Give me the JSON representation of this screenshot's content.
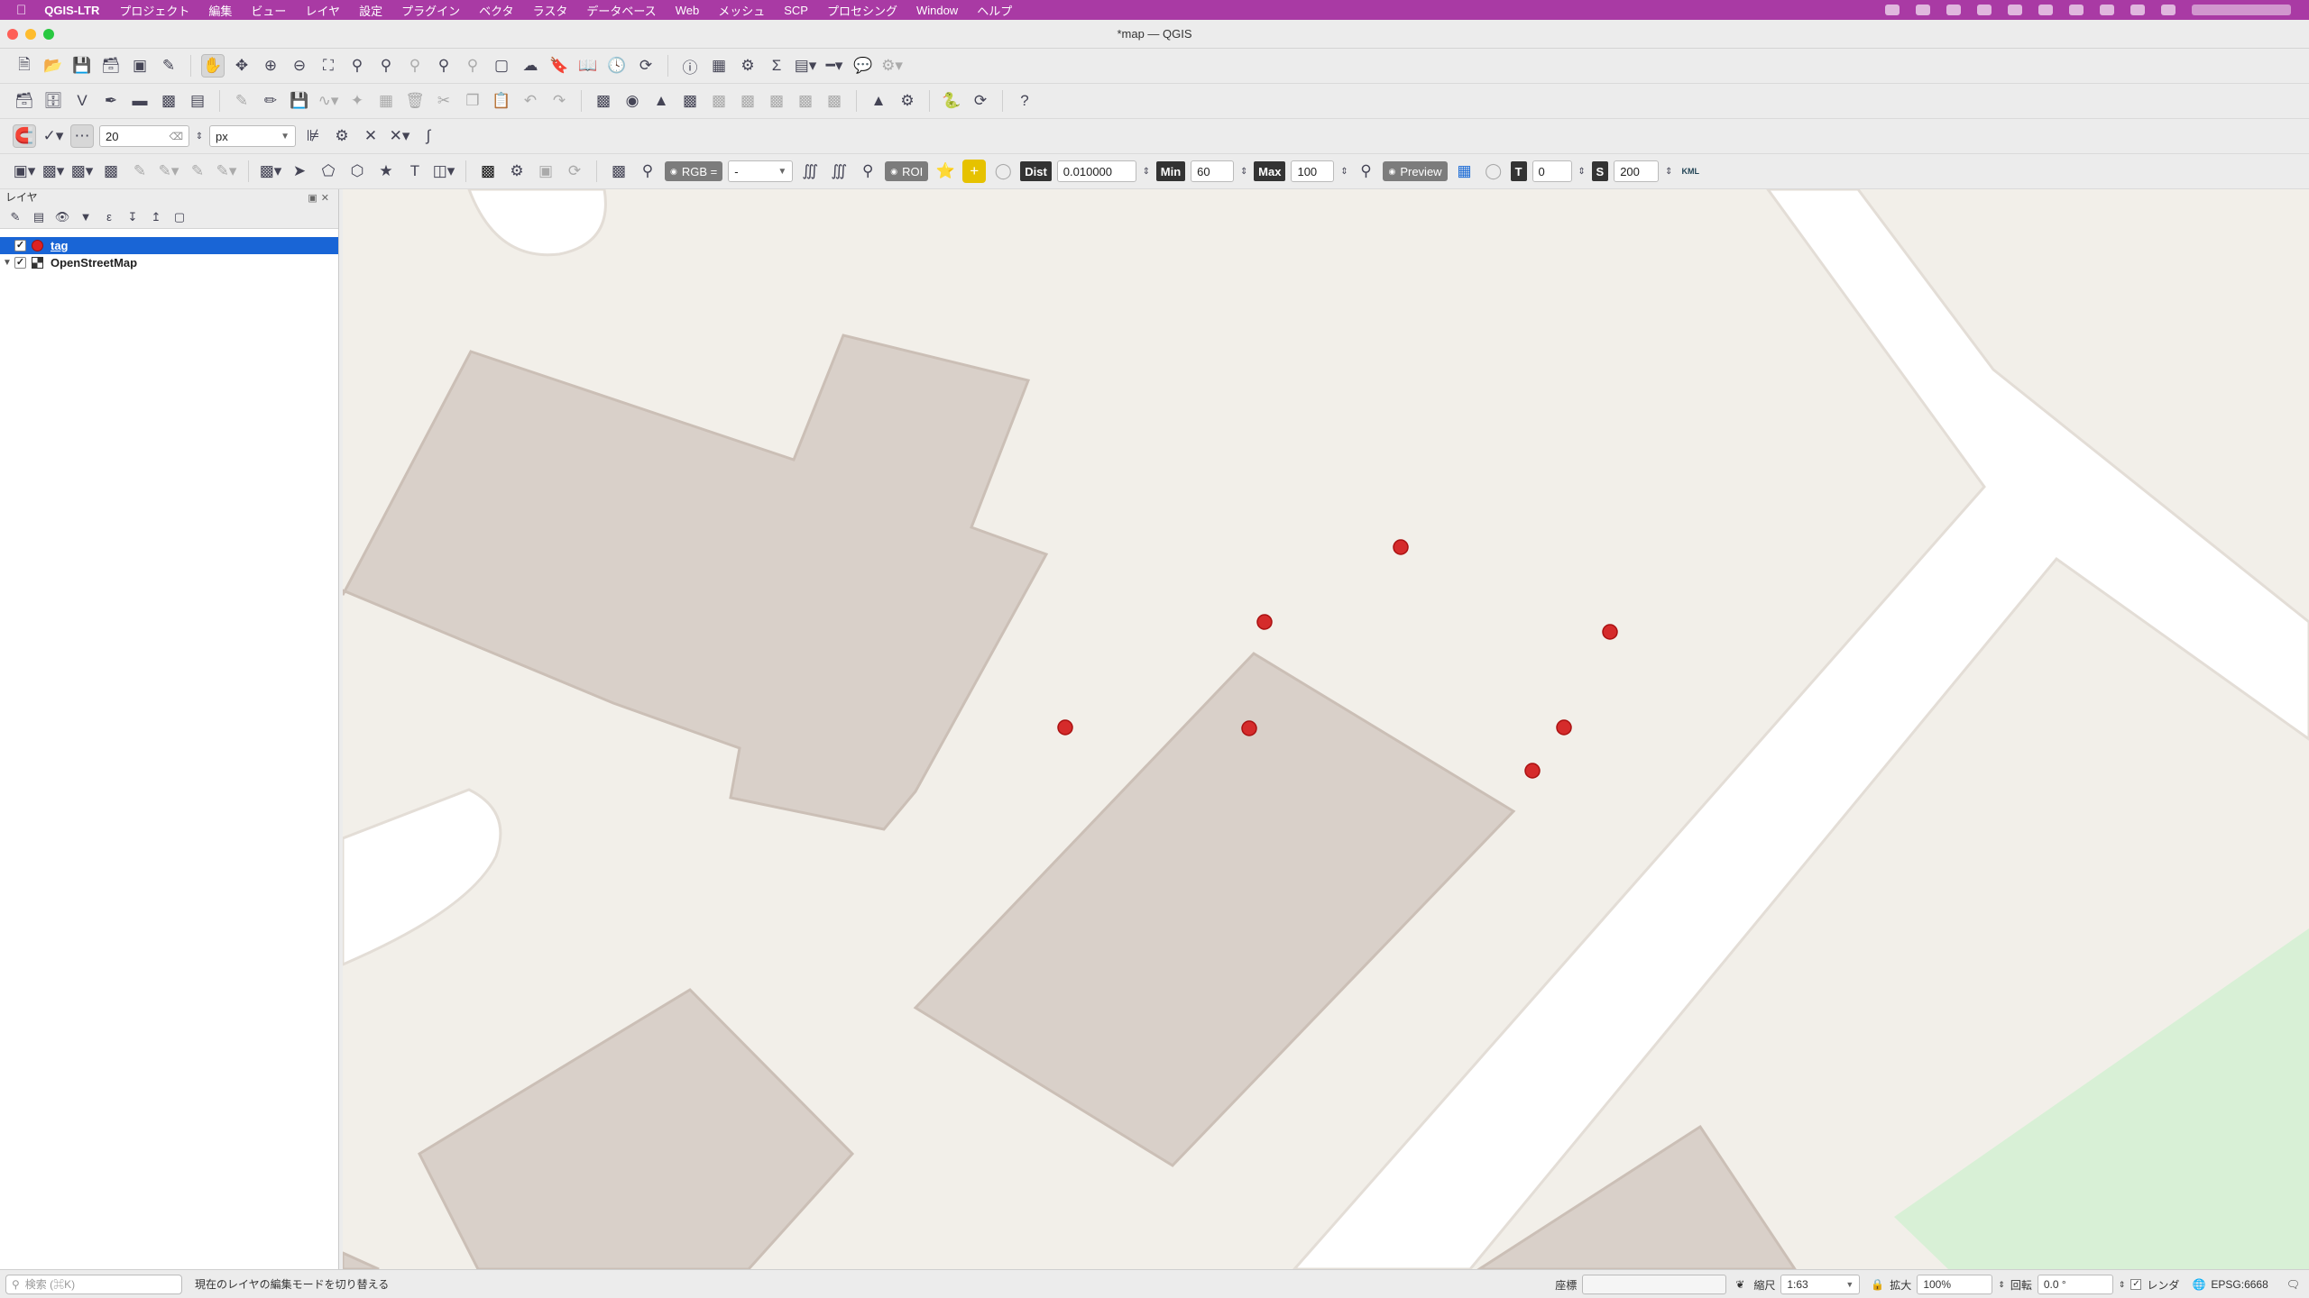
{
  "menubar": {
    "app_name": "QGIS-LTR",
    "items": [
      "プロジェクト",
      "編集",
      "ビュー",
      "レイヤ",
      "設定",
      "プラグイン",
      "ベクタ",
      "ラスタ",
      "データベース",
      "Web",
      "メッシュ",
      "SCP",
      "プロセシング",
      "Window",
      "ヘルプ"
    ]
  },
  "window": {
    "title": "*map — QGIS"
  },
  "snapping_toolbar": {
    "tolerance_value": "20",
    "unit": "px"
  },
  "scp_toolbar": {
    "rgb_label": "RGB =",
    "rgb_value": "-",
    "roi_label": "ROI",
    "dist_label": "Dist",
    "dist_value": "0.010000",
    "min_label": "Min",
    "min_value": "60",
    "max_label": "Max",
    "max_value": "100",
    "preview_label": "Preview",
    "t_label": "T",
    "t_value": "0",
    "s_label": "S",
    "s_value": "200",
    "kml_label": "KML"
  },
  "layers_panel": {
    "title": "レイヤ",
    "layers": [
      {
        "name": "tag",
        "checked": true,
        "selected": true,
        "type": "point"
      },
      {
        "name": "OpenStreetMap",
        "checked": true,
        "selected": false,
        "type": "raster"
      }
    ]
  },
  "statusbar": {
    "search_placeholder": "検索 (⌘K)",
    "message": "現在のレイヤの編集モードを切り替える",
    "coordinate_label": "座標",
    "scale_label": "縮尺",
    "scale_value": "1:63",
    "magnifier_label": "拡大",
    "magnifier_value": "100%",
    "rotation_label": "回転",
    "rotation_value": "0.0 °",
    "render_label": "レンダ",
    "crs": "EPSG:6668"
  },
  "colors": {
    "menubar": "#a93aa4",
    "selection": "#1965d6",
    "point": "#d52b2b",
    "building": "#d9d0c9",
    "land": "#f2efe9"
  }
}
